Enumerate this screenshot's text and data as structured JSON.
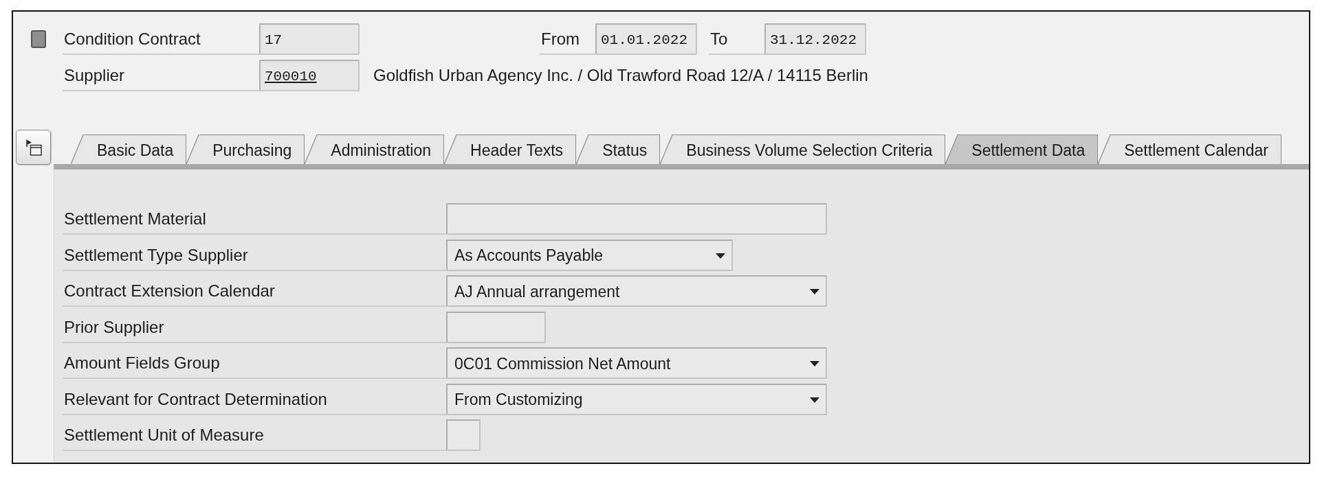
{
  "header": {
    "fields": [
      {
        "label": "Condition Contract",
        "value": "17",
        "link": false
      },
      {
        "label": "Supplier",
        "value": "700010",
        "link": true,
        "description": "Goldfish Urban Agency Inc. / Old Trawford Road 12/A / 14115 Berlin"
      }
    ],
    "validity": [
      {
        "label": "From",
        "value": "01.01.2022"
      },
      {
        "label": "To",
        "value": "31.12.2022"
      }
    ]
  },
  "tabs": [
    {
      "label": "Basic Data",
      "selected": false
    },
    {
      "label": "Purchasing",
      "selected": false
    },
    {
      "label": "Administration",
      "selected": false
    },
    {
      "label": "Header Texts",
      "selected": false
    },
    {
      "label": "Status",
      "selected": false
    },
    {
      "label": "Business Volume Selection Criteria",
      "selected": false
    },
    {
      "label": "Settlement Data",
      "selected": true
    },
    {
      "label": "Settlement Calendar",
      "selected": false
    }
  ],
  "settlement_data": {
    "rows": [
      {
        "label": "Settlement Material",
        "kind": "input"
      },
      {
        "label": "Settlement Type Supplier",
        "kind": "dropdown",
        "value": "As Accounts Payable"
      },
      {
        "label": "Contract Extension Calendar",
        "kind": "dropdown",
        "value": "AJ Annual arrangement"
      },
      {
        "label": "Prior Supplier",
        "kind": "input"
      },
      {
        "label": "Amount Fields Group",
        "kind": "dropdown",
        "value": "0C01 Commission Net Amount"
      },
      {
        "label": "Relevant for Contract Determination",
        "kind": "dropdown",
        "value": "From Customizing"
      },
      {
        "label": "Settlement Unit of Measure",
        "kind": "input"
      }
    ]
  }
}
